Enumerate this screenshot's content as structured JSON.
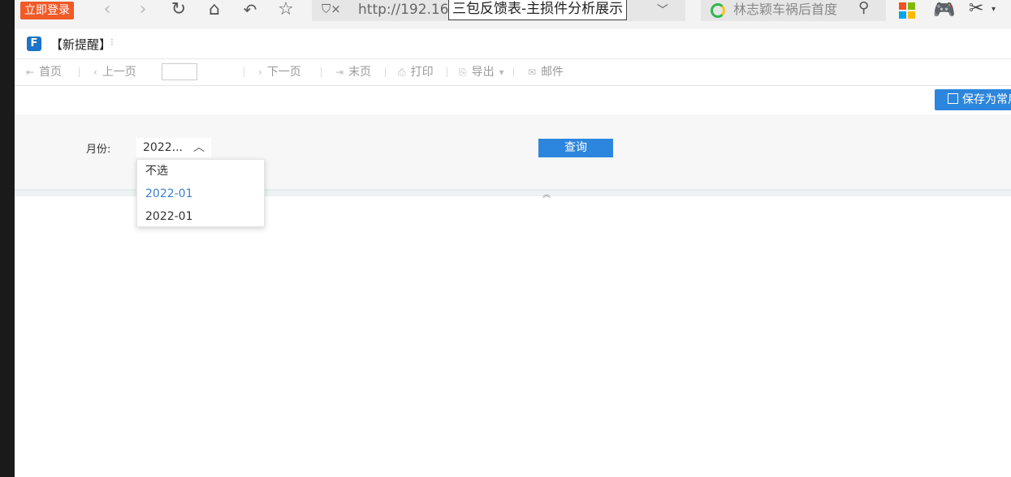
{
  "browser": {
    "login_label": "立即登录",
    "url": "http://192.16",
    "tab_title": "三包反馈表-主损件分析展示",
    "search_text": "林志颖车祸后首度",
    "icons": [
      "back-icon",
      "forward-icon",
      "reload-icon",
      "home-icon",
      "undo-icon",
      "star-icon",
      "shield-icon",
      "search-icon",
      "windows-icon",
      "game-icon",
      "scissors-icon"
    ]
  },
  "app": {
    "title": "【新提醒】"
  },
  "toolbar": {
    "first": "首页",
    "prev": "上一页",
    "next": "下一页",
    "last": "末页",
    "print": "打印",
    "export": "导出",
    "mail": "邮件"
  },
  "save_label": "保存为常用",
  "params": {
    "month_label": "月份:",
    "month_value": "2022...",
    "query_label": "查询",
    "options": [
      "不选",
      "2022-01",
      "2022-01"
    ],
    "selected_index": 1
  },
  "colors": {
    "accent": "#2d86dd",
    "login": "#f05a28",
    "selected_option": "#3d7fd4"
  }
}
